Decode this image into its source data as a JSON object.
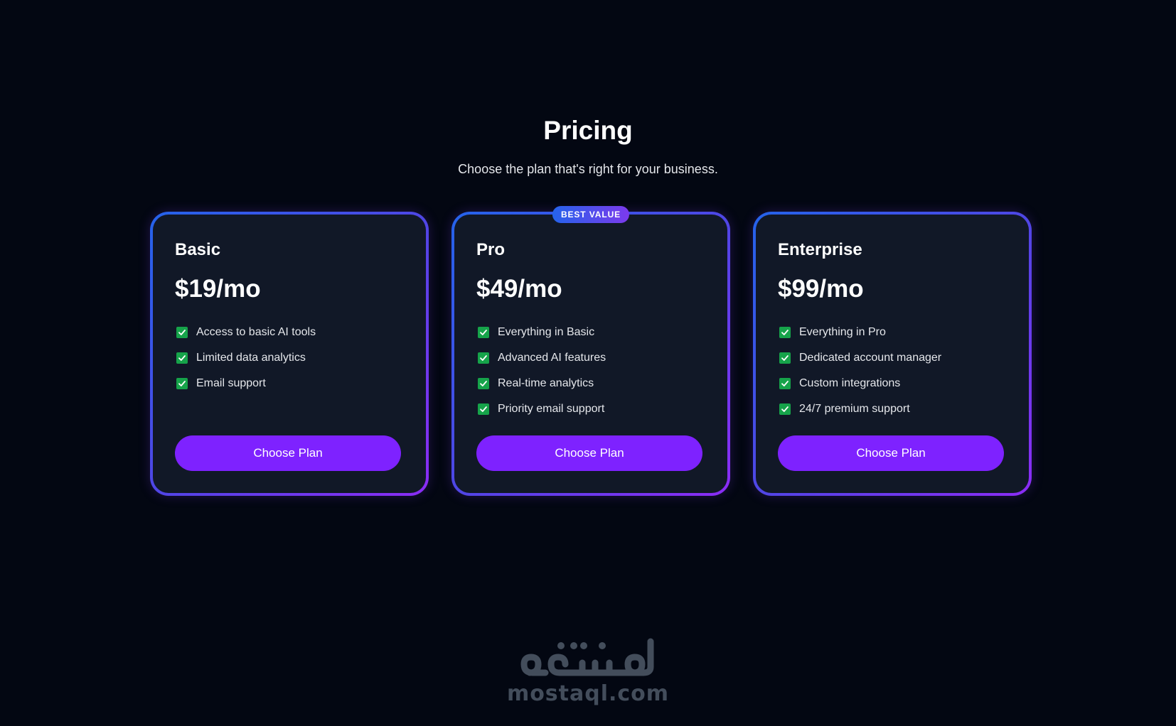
{
  "header": {
    "title": "Pricing",
    "subtitle": "Choose the plan that's right for your business."
  },
  "plans": [
    {
      "name": "Basic",
      "price": "$19/mo",
      "badge": "",
      "features": [
        "Access to basic AI tools",
        "Limited data analytics",
        "Email support"
      ],
      "button_label": "Choose Plan"
    },
    {
      "name": "Pro",
      "price": "$49/mo",
      "badge": "BEST VALUE",
      "features": [
        "Everything in Basic",
        "Advanced AI features",
        "Real-time analytics",
        "Priority email support"
      ],
      "button_label": "Choose Plan"
    },
    {
      "name": "Enterprise",
      "price": "$99/mo",
      "badge": "",
      "features": [
        "Everything in Pro",
        "Dedicated account manager",
        "Custom integrations",
        "24/7 premium support"
      ],
      "button_label": "Choose Plan"
    }
  ],
  "watermark": {
    "arabic": "مستقل",
    "latin": "mostaql.com"
  },
  "icons": {
    "feature_check": "check-icon"
  },
  "colors": {
    "background": "#030712",
    "card_background": "#111827",
    "border_gradient_start": "#2563eb",
    "border_gradient_end": "#8b2cf5",
    "button": "#7e22ff",
    "check": "#16a34a"
  }
}
